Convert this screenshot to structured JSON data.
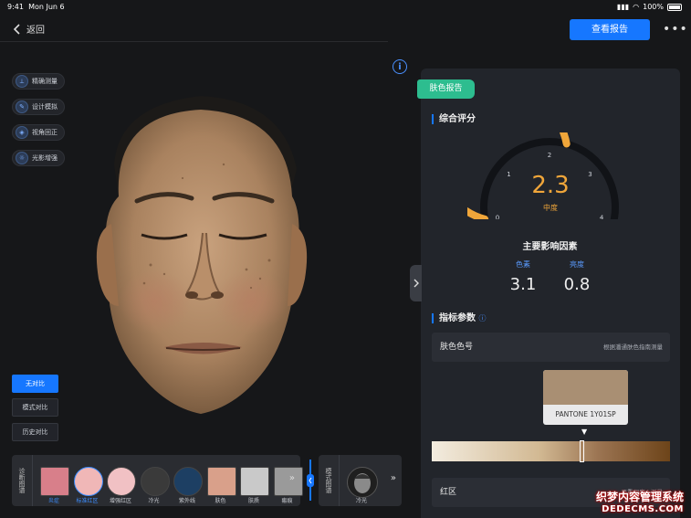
{
  "status_bar": {
    "time": "9:41",
    "date": "Mon Jun 6",
    "battery": "100%"
  },
  "nav": {
    "back_label": "返回",
    "report_button": "查看报告",
    "more": "•••"
  },
  "tools": [
    {
      "label": "精确测量",
      "icon": "ruler-icon"
    },
    {
      "label": "设计模拟",
      "icon": "pencil-icon"
    },
    {
      "label": "视角回正",
      "icon": "cube-icon"
    },
    {
      "label": "光影增强",
      "icon": "sun-icon"
    }
  ],
  "compare_buttons": [
    {
      "label": "无对比",
      "active": true
    },
    {
      "label": "模式对比",
      "active": false
    },
    {
      "label": "历史对比",
      "active": false
    }
  ],
  "strip": {
    "label": "诊断图谱",
    "items": [
      {
        "label": "炎症",
        "color": "#d87f8a",
        "selected": true
      },
      {
        "label": "标准红区",
        "color": "#f0b7b7",
        "selected": true
      },
      {
        "label": "增强红区",
        "color": "#f1c1c4",
        "selected": false
      },
      {
        "label": "冷光",
        "color": "#3a3a3a",
        "selected": false
      },
      {
        "label": "紫外线",
        "color": "#1d3f63",
        "selected": false
      },
      {
        "label": "肤色",
        "color": "#d9a08a",
        "selected": false
      },
      {
        "label": "肤质",
        "color": "#c9c9c9",
        "selected": false
      },
      {
        "label": "瘢痕",
        "color": "#9a9a9a",
        "selected": false
      }
    ],
    "more": "»"
  },
  "strip2": {
    "label": "模式图谱",
    "item": "冷光",
    "more": "»"
  },
  "panel": {
    "tag": "肤色报告",
    "overall_title": "综合评分",
    "gauge": {
      "value": "2.3",
      "level": "中度",
      "ticks": [
        "0",
        "1",
        "2",
        "3",
        "4"
      ],
      "min": 0,
      "max": 4,
      "score": 2.3
    },
    "factors_title": "主要影响因素",
    "factors": [
      {
        "label": "色素",
        "value": "3.1"
      },
      {
        "label": "亮度",
        "value": "0.8"
      }
    ],
    "params_title": "指标参数",
    "rows": [
      {
        "key": "肤色色号",
        "value": "根据潘通肤色指南测量"
      },
      {
        "key": "红区",
        "value": "严重程度 | 测量"
      }
    ],
    "swatch": {
      "name": "PANTONE 1Y01SP",
      "color": "#a98f73"
    },
    "slider_position": 0.63
  },
  "watermark": {
    "line1": "织梦内容管理系统",
    "line2": "DEDECMS.COM"
  }
}
